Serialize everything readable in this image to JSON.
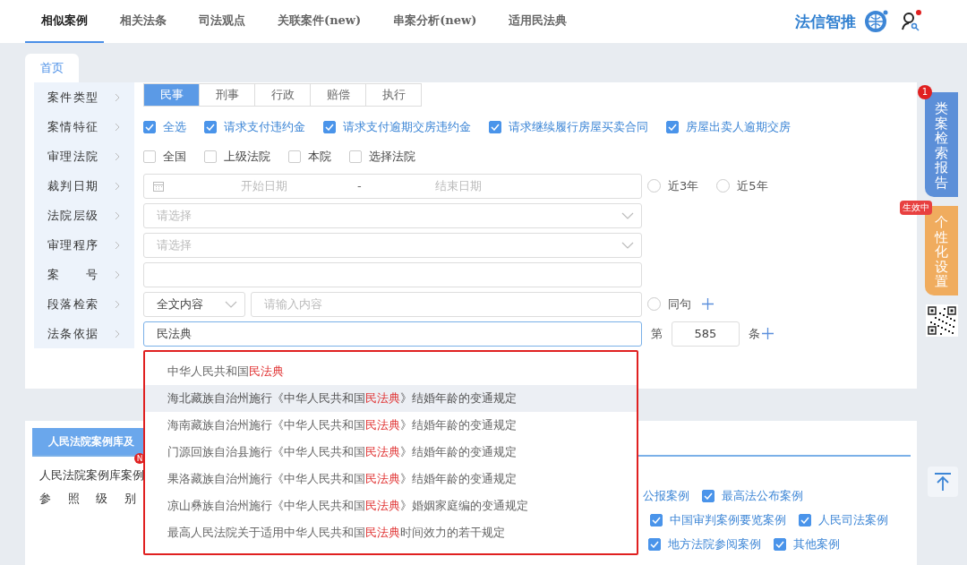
{
  "nav": {
    "tabs": [
      {
        "label": "相似案例",
        "selected": true
      },
      {
        "label": "相关法条",
        "selected": false
      },
      {
        "label": "司法观点",
        "selected": false
      },
      {
        "label": "关联案件(new)",
        "selected": false
      },
      {
        "label": "串案分析(new)",
        "selected": false
      },
      {
        "label": "适用民法典",
        "selected": false
      }
    ],
    "logo": "法信智推",
    "user_notice": true
  },
  "page_tab": {
    "label": "首页",
    "selected": true
  },
  "form": [
    {
      "label": "案件类型",
      "kind": "segmented",
      "options": [
        {
          "label": "民事",
          "selected": true
        },
        {
          "label": "刑事",
          "selected": false
        },
        {
          "label": "行政",
          "selected": false
        },
        {
          "label": "赔偿",
          "selected": false
        },
        {
          "label": "执行",
          "selected": false
        }
      ]
    },
    {
      "label": "案情特征",
      "kind": "checks",
      "options": [
        {
          "label": "全选",
          "checked": true
        },
        {
          "label": "请求支付违约金",
          "checked": true
        },
        {
          "label": "请求支付逾期交房违约金",
          "checked": true
        },
        {
          "label": "请求继续履行房屋买卖合同",
          "checked": true
        },
        {
          "label": "房屋出卖人逾期交房",
          "checked": true
        }
      ]
    },
    {
      "label": "审理法院",
      "kind": "checks",
      "options": [
        {
          "label": "全国",
          "checked": false
        },
        {
          "label": "上级法院",
          "checked": false
        },
        {
          "label": "本院",
          "checked": false
        },
        {
          "label": "选择法院",
          "checked": false
        }
      ]
    },
    {
      "label": "裁判日期",
      "kind": "date_range",
      "start_placeholder": "开始日期",
      "separator": "-",
      "end_placeholder": "结束日期",
      "radios": [
        {
          "label": "近3年",
          "selected": false
        },
        {
          "label": "近5年",
          "selected": false
        }
      ]
    },
    {
      "label": "法院层级",
      "kind": "select",
      "placeholder": "请选择"
    },
    {
      "label": "审理程序",
      "kind": "select",
      "placeholder": "请选择"
    },
    {
      "label": "案号",
      "kind": "text"
    },
    {
      "label": "段落检索",
      "kind": "paragraph",
      "scope": "全文内容",
      "placeholder": "请输入内容",
      "radio": {
        "label": "同句",
        "selected": false
      }
    },
    {
      "label": "法条依据",
      "kind": "law",
      "value": "民法典",
      "prefix": "第",
      "article": "585",
      "suffix": "条"
    }
  ],
  "suggestions": [
    {
      "before": "中华人民共和国",
      "match": "民法典",
      "highlighted": false
    },
    {
      "before": "海北藏族自治州施行《中华人民共和国",
      "match": "民法典",
      "after": "》结婚年龄的变通规定",
      "highlighted": true
    },
    {
      "before": "海南藏族自治州施行《中华人民共和国",
      "match": "民法典",
      "after": "》结婚年龄的变通规定",
      "highlighted": false
    },
    {
      "before": "门源回族自治县施行《中华人民共和国",
      "match": "民法典",
      "after": "》结婚年龄的变通规定",
      "highlighted": false
    },
    {
      "before": "果洛藏族自治州施行《中华人民共和国",
      "match": "民法典",
      "after": "》结婚年龄的变通规定",
      "highlighted": false
    },
    {
      "before": "凉山彝族自治州施行《中华人民共和国",
      "match": "民法典",
      "after": "》婚姻家庭编的变通规定",
      "highlighted": false
    },
    {
      "before": "最高人民法院关于适用中华人民共和国",
      "match": "民法典",
      "after": "时间效力的若干规定",
      "highlighted": false
    }
  ],
  "side": {
    "report": {
      "label": "类案检索报告",
      "badge": "1"
    },
    "settings": {
      "label": "个性化设置",
      "badge": "生效中"
    }
  },
  "library": {
    "tab": "人民法院案例库及",
    "badge": "N",
    "line": "人民法院案例库案例",
    "level_label": "参照级别",
    "rows": [
      [
        {
          "label": "公报案例"
        },
        {
          "label": "最高法公布案例",
          "checked": true
        }
      ],
      [
        {
          "label": "中国审判案例要览案例",
          "checked": true
        },
        {
          "label": "人民司法案例",
          "checked": true
        }
      ],
      [
        {
          "label": "地方法院参阅案例",
          "checked": true
        },
        {
          "label": "其他案例",
          "checked": true
        }
      ]
    ]
  }
}
